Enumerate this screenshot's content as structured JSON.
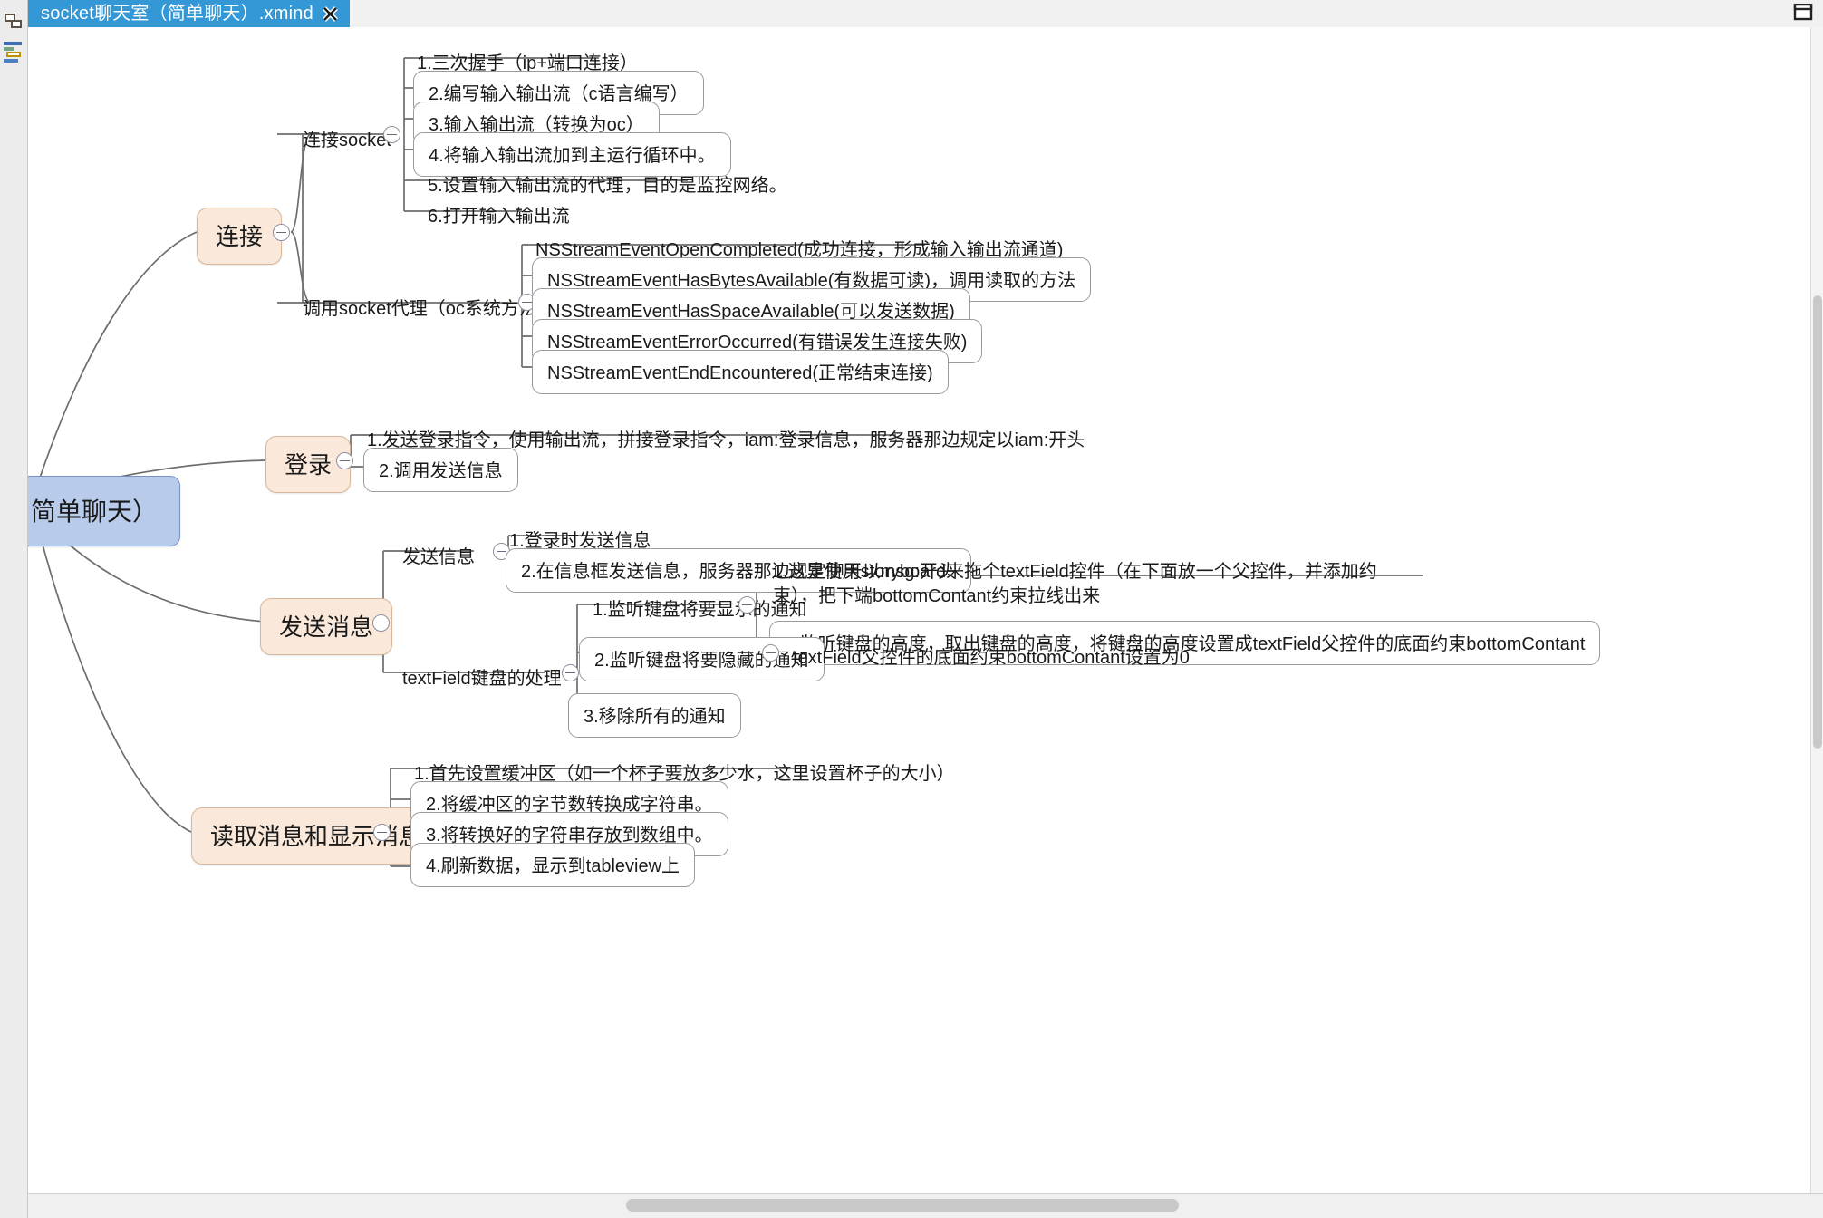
{
  "window": {
    "tab_title": "socket聊天室（简单聊天）.xmind",
    "close_icon": "close-x-icon",
    "restore_icon": "restore-window-icon",
    "accent_color": "#3498d6"
  },
  "rail": {
    "items": [
      {
        "icon": "structure-outline-icon",
        "label": ""
      },
      {
        "icon": "gantt-bars-icon",
        "label": ""
      }
    ]
  },
  "map": {
    "root": {
      "label": "简单聊天）"
    },
    "branches": [
      {
        "label": "连接",
        "children": [
          {
            "label": "连接socket",
            "children": [
              {
                "label": "1.三次握手（ip+端口连接）"
              },
              {
                "label": "2.编写输入输出流（c语言编写）"
              },
              {
                "label": "3.输入输出流（转换为oc）"
              },
              {
                "label": "4.将输入输出流加到主运行循环中。"
              },
              {
                "label": "5.设置输入输出流的代理，目的是监控网络。"
              },
              {
                "label": "6.打开输入输出流"
              }
            ]
          },
          {
            "label": "调用socket代理（oc系统方法）",
            "children": [
              {
                "label": "NSStreamEventOpenCompleted(成功连接，形成输入输出流通道)"
              },
              {
                "label": "NSStreamEventHasBytesAvailable(有数据可读)，调用读取的方法"
              },
              {
                "label": "NSStreamEventHasSpaceAvailable(可以发送数据)"
              },
              {
                "label": "NSStreamEventErrorOccurred(有错误发生连接失败)"
              },
              {
                "label": "NSStreamEventEndEncountered(正常结束连接)"
              }
            ]
          }
        ]
      },
      {
        "label": "登录",
        "children": [
          {
            "label": "1.发送登录指令，使用输出流，拼接登录指令，iam:登录信息，服务器那边规定以iam:开头"
          },
          {
            "label": "2.调用发送信息"
          }
        ]
      },
      {
        "label": "发送消息",
        "children": [
          {
            "label": "发送信息",
            "children": [
              {
                "label": "1.登录时发送信息"
              },
              {
                "label": "2.在信息框发送信息，服务器那边规定聊天以msg:开头"
              }
            ]
          },
          {
            "label": "textField键盘的处理",
            "children": [
              {
                "label": "1.监听键盘将要显示的通知",
                "children": [
                  {
                    "label": "1.这里使用storyboard来拖个textField控件（在下面放一个父控件，并添加约束），把下端bottomContant约束拉线出来"
                  },
                  {
                    "label": "2.监听键盘的高度，取出键盘的高度，将键盘的高度设置成textField父控件的底面约束bottomContant"
                  }
                ]
              },
              {
                "label": "2.监听键盘将要隐藏的通知",
                "children": [
                  {
                    "label": "textField父控件的底面约束bottomContant设置为0"
                  }
                ]
              },
              {
                "label": "3.移除所有的通知"
              }
            ]
          }
        ]
      },
      {
        "label": "读取消息和显示消息",
        "children": [
          {
            "label": "1.首先设置缓冲区（如一个杯子要放多少水，这里设置杯子的大小）"
          },
          {
            "label": "2.将缓冲区的字节数转换成字符串。"
          },
          {
            "label": "3.将转换好的字符串存放到数组中。"
          },
          {
            "label": "4.刷新数据，显示到tableview上"
          }
        ]
      }
    ]
  },
  "scroll": {
    "horizontal_label": "horizontal-scrollbar",
    "vertical_label": "vertical-scrollbar"
  }
}
